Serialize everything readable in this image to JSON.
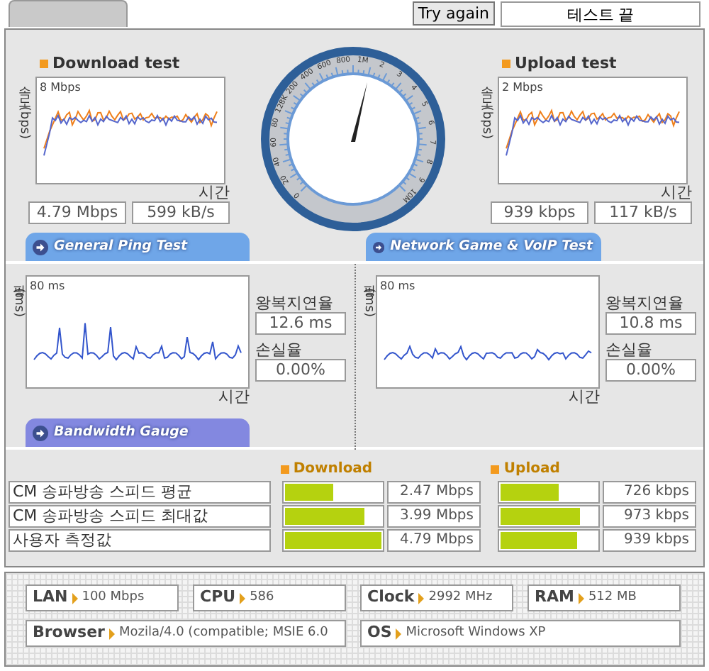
{
  "try_again": "Try again",
  "status_field": "테스트 끝",
  "speed_tests": [
    {
      "title": "Download test",
      "y_label": "속도 (bps)",
      "top_label": "8 Mbps",
      "x_label": "시간",
      "readings": [
        "4.79 Mbps",
        "599 kB/s"
      ]
    },
    {
      "title": "Upload test",
      "y_label": "속도 (bps)",
      "top_label": "2 Mbps",
      "x_label": "시간",
      "readings": [
        "939 kbps",
        "117 kB/s"
      ]
    }
  ],
  "gauge": {
    "labels": [
      "0",
      "20",
      "40",
      "60",
      "80",
      "128K",
      "200",
      "400",
      "600",
      "800",
      "1M",
      "2",
      "3",
      "4",
      "5",
      "6",
      "7",
      "8",
      "9",
      "10M"
    ]
  },
  "section_tabs": [
    {
      "label": "General Ping Test",
      "color": "#6fa6e8"
    },
    {
      "label": "Network Game & VoIP Test",
      "color": "#6fa6e8"
    },
    {
      "label": "Bandwidth Gauge",
      "color": "#8388e0"
    }
  ],
  "ping_tests": [
    {
      "y_label": "핑(ms)",
      "top_label": "80 ms",
      "x_label": "시간",
      "latency_label": "왕복지연율",
      "latency": "12.6 ms",
      "loss_label": "손실율",
      "loss": "0.00%"
    },
    {
      "y_label": "핑(ms)",
      "top_label": "80 ms",
      "x_label": "시간",
      "latency_label": "왕복지연율",
      "latency": "10.8 ms",
      "loss_label": "손실율",
      "loss": "0.00%"
    }
  ],
  "bandwidth": {
    "columns": [
      "Download",
      "Upload"
    ],
    "rows": [
      {
        "label": "CM 송파방송 스피드 평균",
        "download": {
          "level": 0.5,
          "reading": "2.47 Mbps"
        },
        "upload": {
          "level": 0.6,
          "reading": "726 kbps"
        }
      },
      {
        "label": "CM 송파방송 스피드 최대값",
        "download": {
          "level": 0.83,
          "reading": "3.99 Mbps"
        },
        "upload": {
          "level": 0.83,
          "reading": "973 kbps"
        }
      },
      {
        "label": "사용자 측정값",
        "download": {
          "level": 1.0,
          "reading": "4.79 Mbps"
        },
        "upload": {
          "level": 0.79,
          "reading": "939 kbps"
        }
      }
    ]
  },
  "system_info": [
    {
      "label": "LAN",
      "value": "100 Mbps"
    },
    {
      "label": "CPU",
      "value": "586"
    },
    {
      "label": "Clock",
      "value": "2992 MHz"
    },
    {
      "label": "RAM",
      "value": "512 MB"
    },
    {
      "label": "Browser",
      "value": "Mozila/4.0 (compatible; MSIE 6.0"
    },
    {
      "label": "OS",
      "value": "Microsoft Windows XP"
    }
  ]
}
